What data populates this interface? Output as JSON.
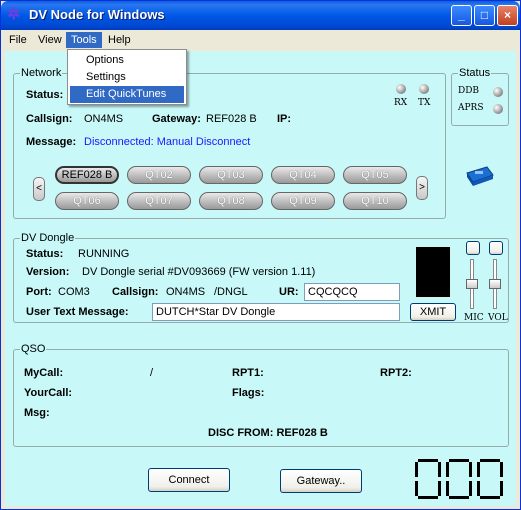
{
  "window": {
    "title": "DV Node for Windows",
    "app_icon": "dv-node-star-icon",
    "min_label": "_",
    "max_label": "□",
    "close_label": "×"
  },
  "menubar": {
    "file": "File",
    "view": "View",
    "tools": "Tools",
    "help": "Help"
  },
  "tools_menu": {
    "items": [
      "Options",
      "Settings",
      "Edit QuickTunes"
    ]
  },
  "network": {
    "group_label": "Network",
    "status_label": "Status:",
    "rx_label": "RX",
    "tx_label": "TX",
    "callsign_label": "Callsign:",
    "callsign": "ON4MS",
    "gateway_label": "Gateway:",
    "gateway": "REF028 B",
    "ip_label": "IP:",
    "message_label": "Message:",
    "message": "Disconnected: Manual Disconnect",
    "quicktunes": [
      "REF028 B",
      "QT02",
      "QT03",
      "QT04",
      "QT05",
      "QT06",
      "QT07",
      "QT08",
      "QT09",
      "QT10"
    ],
    "left_arrow": "<",
    "right_arrow": ">"
  },
  "status": {
    "group_label": "Status",
    "ddb_label": "DDB",
    "aprs_label": "APRS"
  },
  "dongle": {
    "group_label": "DV Dongle",
    "status_label": "Status:",
    "status": "RUNNING",
    "version_label": "Version:",
    "version": "DV Dongle serial #DV093669 (FW version 1.11)",
    "port_label": "Port:",
    "port": "COM3",
    "callsign_label": "Callsign:",
    "callsign": "ON4MS",
    "suffix": "/DNGL",
    "ur_label": "UR:",
    "ur_value": "CQCQCQ",
    "user_text_label": "User Text Message:",
    "user_text": "DUTCH*Star DV Dongle",
    "xmit_label": "XMIT",
    "mic_label": "MIC",
    "vol_label": "VOL"
  },
  "qso": {
    "group_label": "QSO",
    "mycall_label": "MyCall:",
    "mycall_sep": "/",
    "rpt1_label": "RPT1:",
    "rpt2_label": "RPT2:",
    "yourcall_label": "YourCall:",
    "flags_label": "Flags:",
    "msg_label": "Msg:",
    "disc_text": "DISC FROM: REF028 B"
  },
  "bottom": {
    "connect_label": "Connect",
    "gateway_label": "Gateway..",
    "counter": "000"
  }
}
